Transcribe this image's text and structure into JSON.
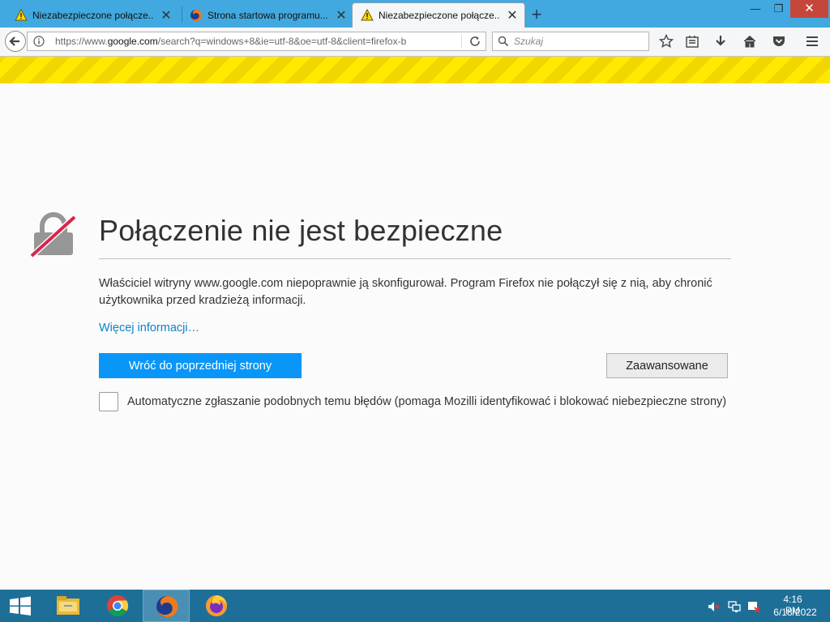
{
  "browser": {
    "tabs": [
      {
        "title": "Niezabezpieczone połącze...",
        "icon": "warning-icon",
        "active": false
      },
      {
        "title": "Strona startowa programu...",
        "icon": "firefox-icon",
        "active": false
      },
      {
        "title": "Niezabezpieczone połącze...",
        "icon": "warning-icon",
        "active": true
      }
    ],
    "url": {
      "prefix": "https://www.",
      "domain": "google.com",
      "rest": "/search?q=windows+8&ie=utf-8&oe=utf-8&client=firefox-b"
    },
    "search_placeholder": "Szukaj"
  },
  "page": {
    "title": "Połączenie nie jest bezpieczne",
    "description": "Właściciel witryny www.google.com niepoprawnie ją skonfigurował. Program Firefox nie połączył się z nią, aby chronić użytkownika przed kradzieżą informacji.",
    "more_info": "Więcej informacji…",
    "go_back_label": "Wróć do poprzedniej strony",
    "advanced_label": "Zaawansowane",
    "report_label": "Automatyczne zgłaszanie podobnych temu błędów (pomaga Mozilli identyfikować i blokować niebezpieczne strony)",
    "report_checked": false
  },
  "taskbar": {
    "items": [
      "file-explorer-icon",
      "chrome-icon",
      "firefox-icon",
      "firefox-dev-icon"
    ],
    "active_item": "firefox-icon",
    "time": "4:16 PM",
    "date": "6/18/2022"
  },
  "colors": {
    "tabstrip": "#41a9df",
    "primary_button": "#0996f8",
    "link": "#0a84c8",
    "warning_stripe": "#ffe900",
    "taskbar": "#1d6f98"
  }
}
